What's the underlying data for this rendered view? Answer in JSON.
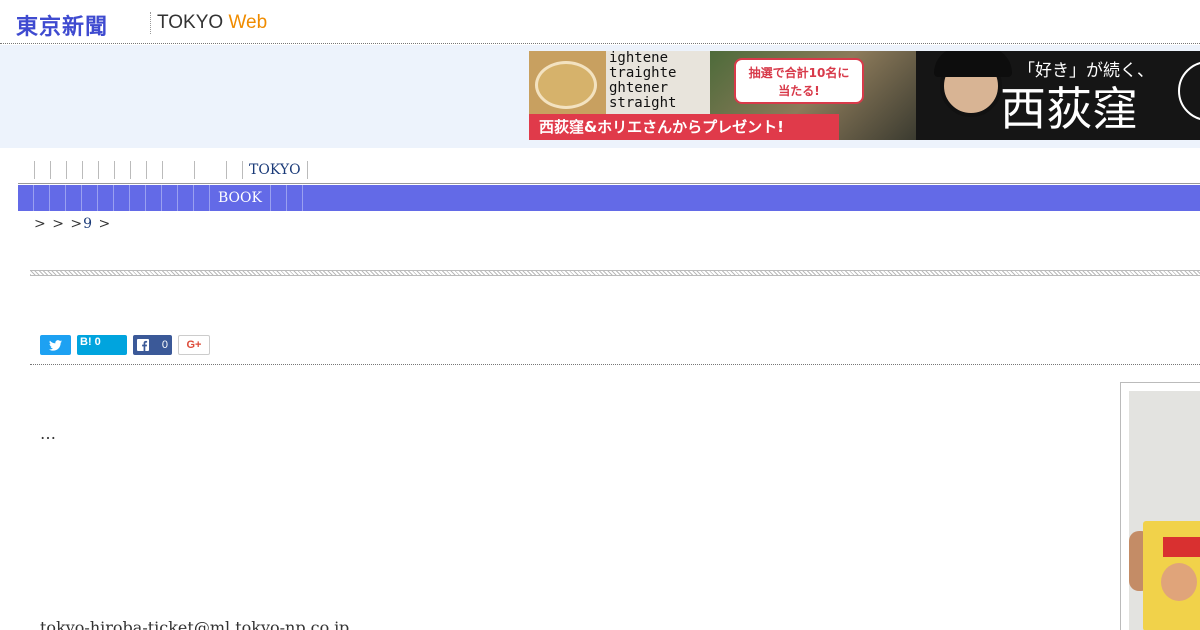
{
  "header": {
    "logo_jp": "東京新聞",
    "logo_tokyo": "TOKYO",
    "logo_web": "Web"
  },
  "ad": {
    "alt_text_lines": [
      "ightene",
      "traighte",
      "ghtener",
      "straight"
    ],
    "bubble_line1": "抽選で合計10名に",
    "bubble_line2": "当たる!",
    "strip_text": "西荻窪&ホリエさんからプレゼント!",
    "copy_small": "「好き」が続く、",
    "copy_big": "西荻窪"
  },
  "nav_top": {
    "tokyo_label": "TOKYO"
  },
  "nav_main": {
    "book_label": "BOOK"
  },
  "breadcrumb": {
    "sep1": ">",
    "sep2": ">",
    "sep3": ">",
    "link": "9",
    "sep4": ">"
  },
  "share": {
    "hatena_label": "B!",
    "hatena_count": "0",
    "facebook_count": "0",
    "gplus_label": "G+"
  },
  "article": {
    "ellipsis": "…",
    "email": "tokyo-hiroba-ticket@ml.tokyo-np.co.jp"
  },
  "colors": {
    "nav_bar": "#636ae7",
    "logo_blue": "#3f4bd0",
    "logo_orange": "#f08c00",
    "banner_bg": "#edf3fc"
  }
}
